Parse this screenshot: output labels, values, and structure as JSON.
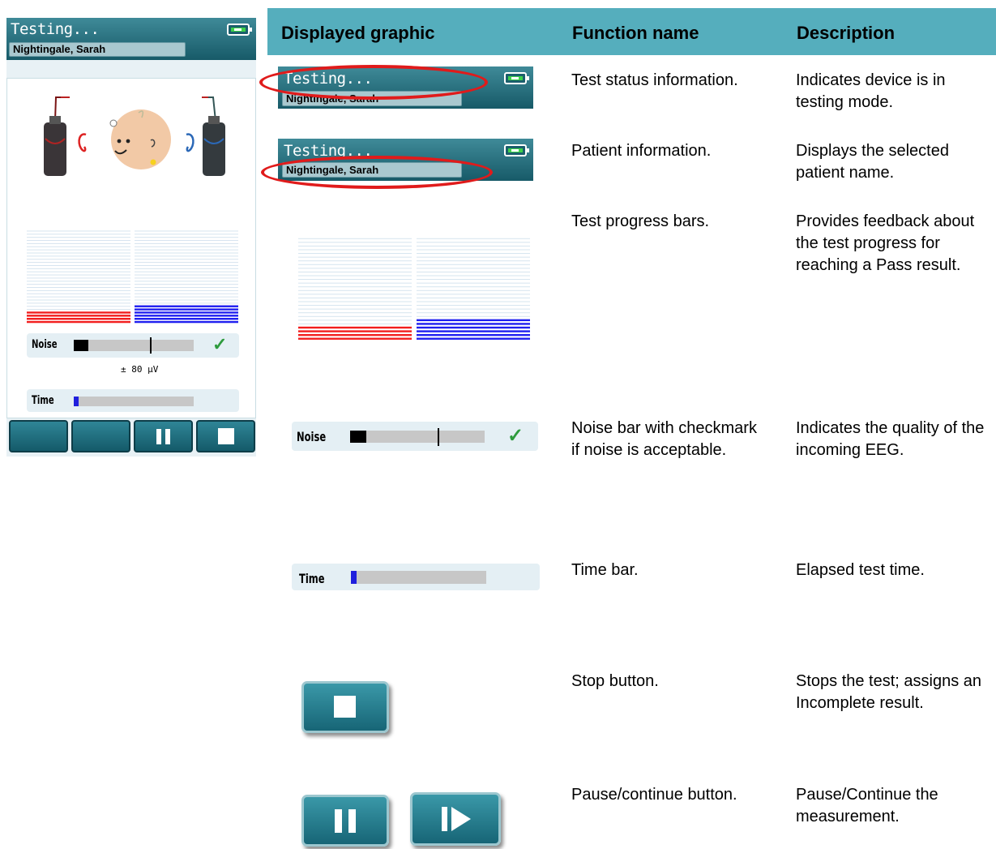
{
  "device": {
    "status_title": "Testing...",
    "patient_name": "Nightingale, Sarah",
    "noise_label": "Noise",
    "noise_range": "± 80 µV",
    "time_label": "Time",
    "noise_level": 0.12,
    "time_progress": 0.04,
    "buttons": [
      "",
      "",
      "pause",
      "stop"
    ]
  },
  "table": {
    "headers": [
      "Displayed graphic",
      "Function name",
      "Description"
    ],
    "rows": [
      {
        "function": "Test status information.",
        "description": "Indicates device is in testing mode."
      },
      {
        "function": "Patient information.",
        "description": "Displays the selected patient name."
      },
      {
        "function": "Test progress bars.",
        "description": "Provides feedback about the test progress for reaching a Pass result."
      },
      {
        "function": "Noise bar with checkmark if noise is acceptable.",
        "description": "Indicates the quality of the incoming EEG."
      },
      {
        "function": "Time bar.",
        "description": "Elapsed test time."
      },
      {
        "function": "Stop button.",
        "description": "Stops the test; assigns an Incomplete result."
      },
      {
        "function": "Pause/continue button.",
        "description": "Pause/Continue the measurement."
      }
    ]
  },
  "colors": {
    "header_teal": "#55aebd",
    "left_bar": "#f21d1d",
    "right_bar": "#1f1ff0",
    "highlight_ellipse": "#e01b1b"
  },
  "icons": [
    "battery-icon",
    "baby-face-icon",
    "left-ear-icon",
    "right-ear-icon",
    "earphone-icon",
    "checkmark-icon",
    "pause-icon",
    "stop-icon",
    "play-icon"
  ]
}
